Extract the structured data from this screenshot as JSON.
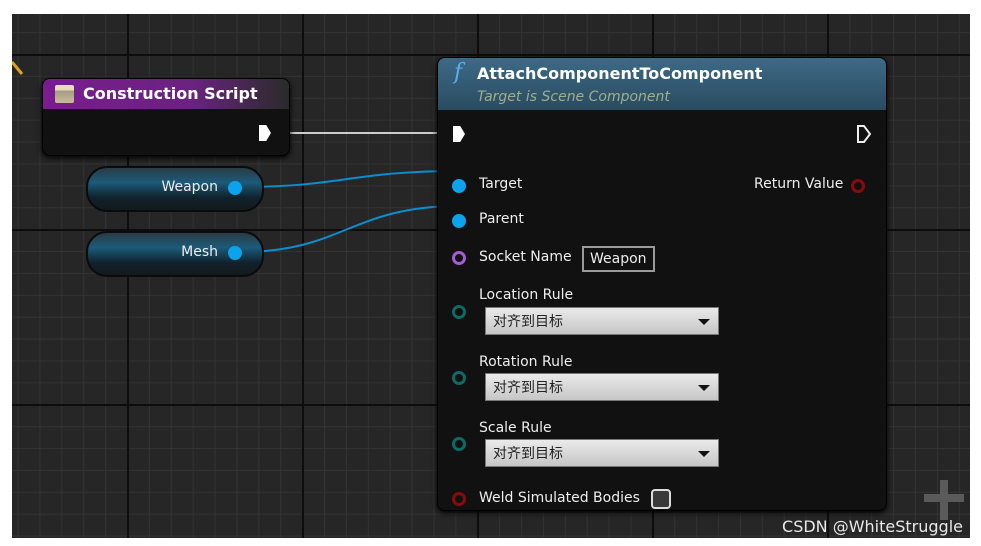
{
  "construction_node": {
    "title": "Construction Script",
    "icon": "construction-script-icon"
  },
  "variables": [
    {
      "name": "Weapon"
    },
    {
      "name": "Mesh"
    }
  ],
  "function_node": {
    "title": "AttachComponentToComponent",
    "subtitle": "Target is Scene Component",
    "pins": {
      "target": "Target",
      "parent": "Parent",
      "socket_name": "Socket Name",
      "return_value": "Return Value",
      "location_rule": "Location Rule",
      "rotation_rule": "Rotation Rule",
      "scale_rule": "Scale Rule",
      "weld": "Weld Simulated Bodies"
    },
    "socket_name_value": "Weapon",
    "location_rule_value": "对齐到目标",
    "rotation_rule_value": "对齐到目标",
    "scale_rule_value": "对齐到目标",
    "weld_checked": false
  },
  "colors": {
    "object_pin": "#0aa3ec",
    "name_pin": "#a45dd4",
    "enum_pin": "#0e6b62",
    "bool_pin": "#8a0b0b",
    "exec": "#ffffff"
  },
  "watermark": "CSDN @WhiteStruggle"
}
